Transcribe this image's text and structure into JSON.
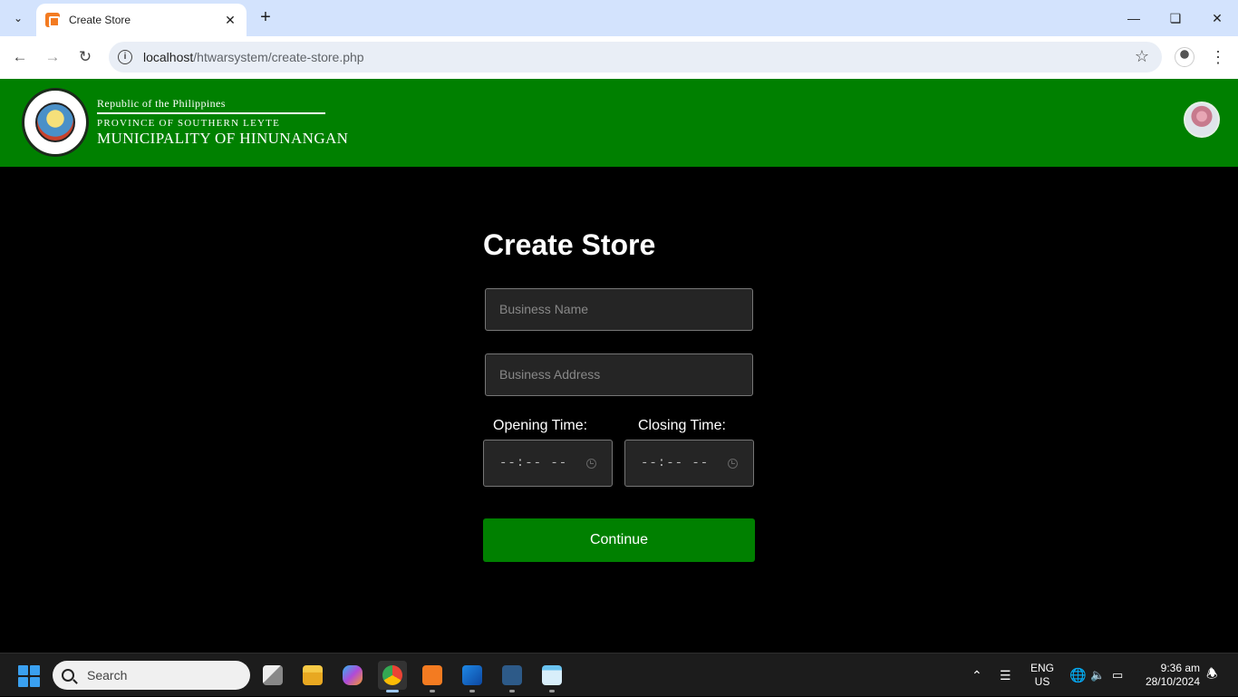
{
  "browser": {
    "tab_title": "Create Store",
    "url_host": "localhost",
    "url_path": "/htwarsystem/create-store.php"
  },
  "header": {
    "line1": "Republic of the Philippines",
    "line2": "PROVINCE OF SOUTHERN LEYTE",
    "line3": "MUNICIPALITY OF HINUNANGAN"
  },
  "form": {
    "title": "Create Store",
    "business_name_placeholder": "Business Name",
    "business_address_placeholder": "Business Address",
    "opening_label": "Opening Time:",
    "closing_label": "Closing Time:",
    "opening_value": "--:-- --",
    "closing_value": "--:-- --",
    "continue_label": "Continue"
  },
  "taskbar": {
    "search_label": "Search",
    "lang_line1": "ENG",
    "lang_line2": "US",
    "time": "9:36 am",
    "date": "28/10/2024"
  },
  "colors": {
    "header_green": "#008000",
    "button_green": "#008000",
    "background": "#000000"
  }
}
